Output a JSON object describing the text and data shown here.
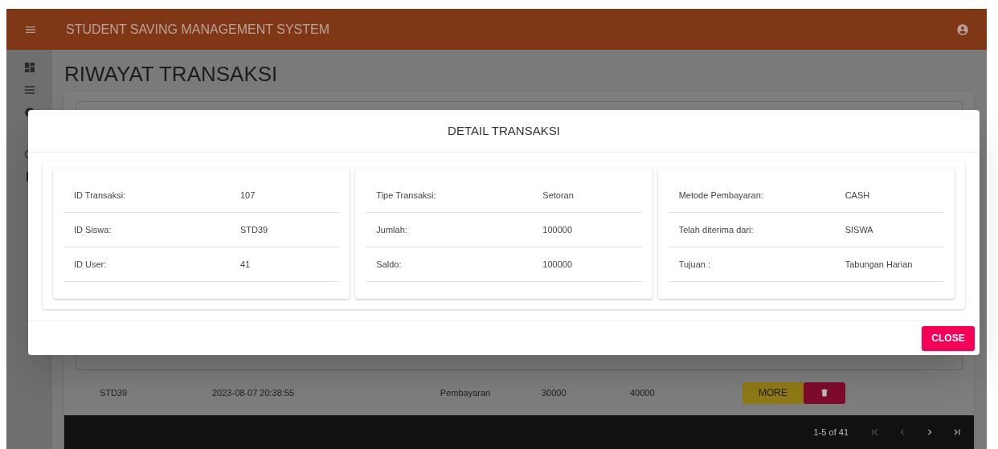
{
  "app_bar": {
    "title": "STUDENT SAVING MANAGEMENT SYSTEM"
  },
  "page_title": "RIWAYAT TRANSAKSI",
  "table": {
    "rows": [
      {
        "cells": [
          "STD39",
          "2023-08-07 20:38:55",
          "Pembayaran",
          "30000",
          "40000"
        ],
        "more": "MORE"
      }
    ],
    "pagination": {
      "range": "1-5 of 41"
    }
  },
  "dialog": {
    "title": "DETAIL TRANSAKSI",
    "cards": [
      {
        "fields": [
          {
            "label": "ID Transaksi:",
            "value": "107"
          },
          {
            "label": "ID Siswa:",
            "value": "STD39"
          },
          {
            "label": "ID User:",
            "value": "41"
          }
        ]
      },
      {
        "fields": [
          {
            "label": "Tipe Transaksi:",
            "value": "Setoran"
          },
          {
            "label": "Jumlah:",
            "value": "100000"
          },
          {
            "label": "Saldo:",
            "value": "100000"
          }
        ]
      },
      {
        "fields": [
          {
            "label": "Metode Pembayaran:",
            "value": "CASH"
          },
          {
            "label": "Telah diterima dari:",
            "value": "SISWA"
          },
          {
            "label": "Tujuan :",
            "value": "Tabungan Harian"
          }
        ]
      }
    ],
    "close": "CLOSE"
  }
}
